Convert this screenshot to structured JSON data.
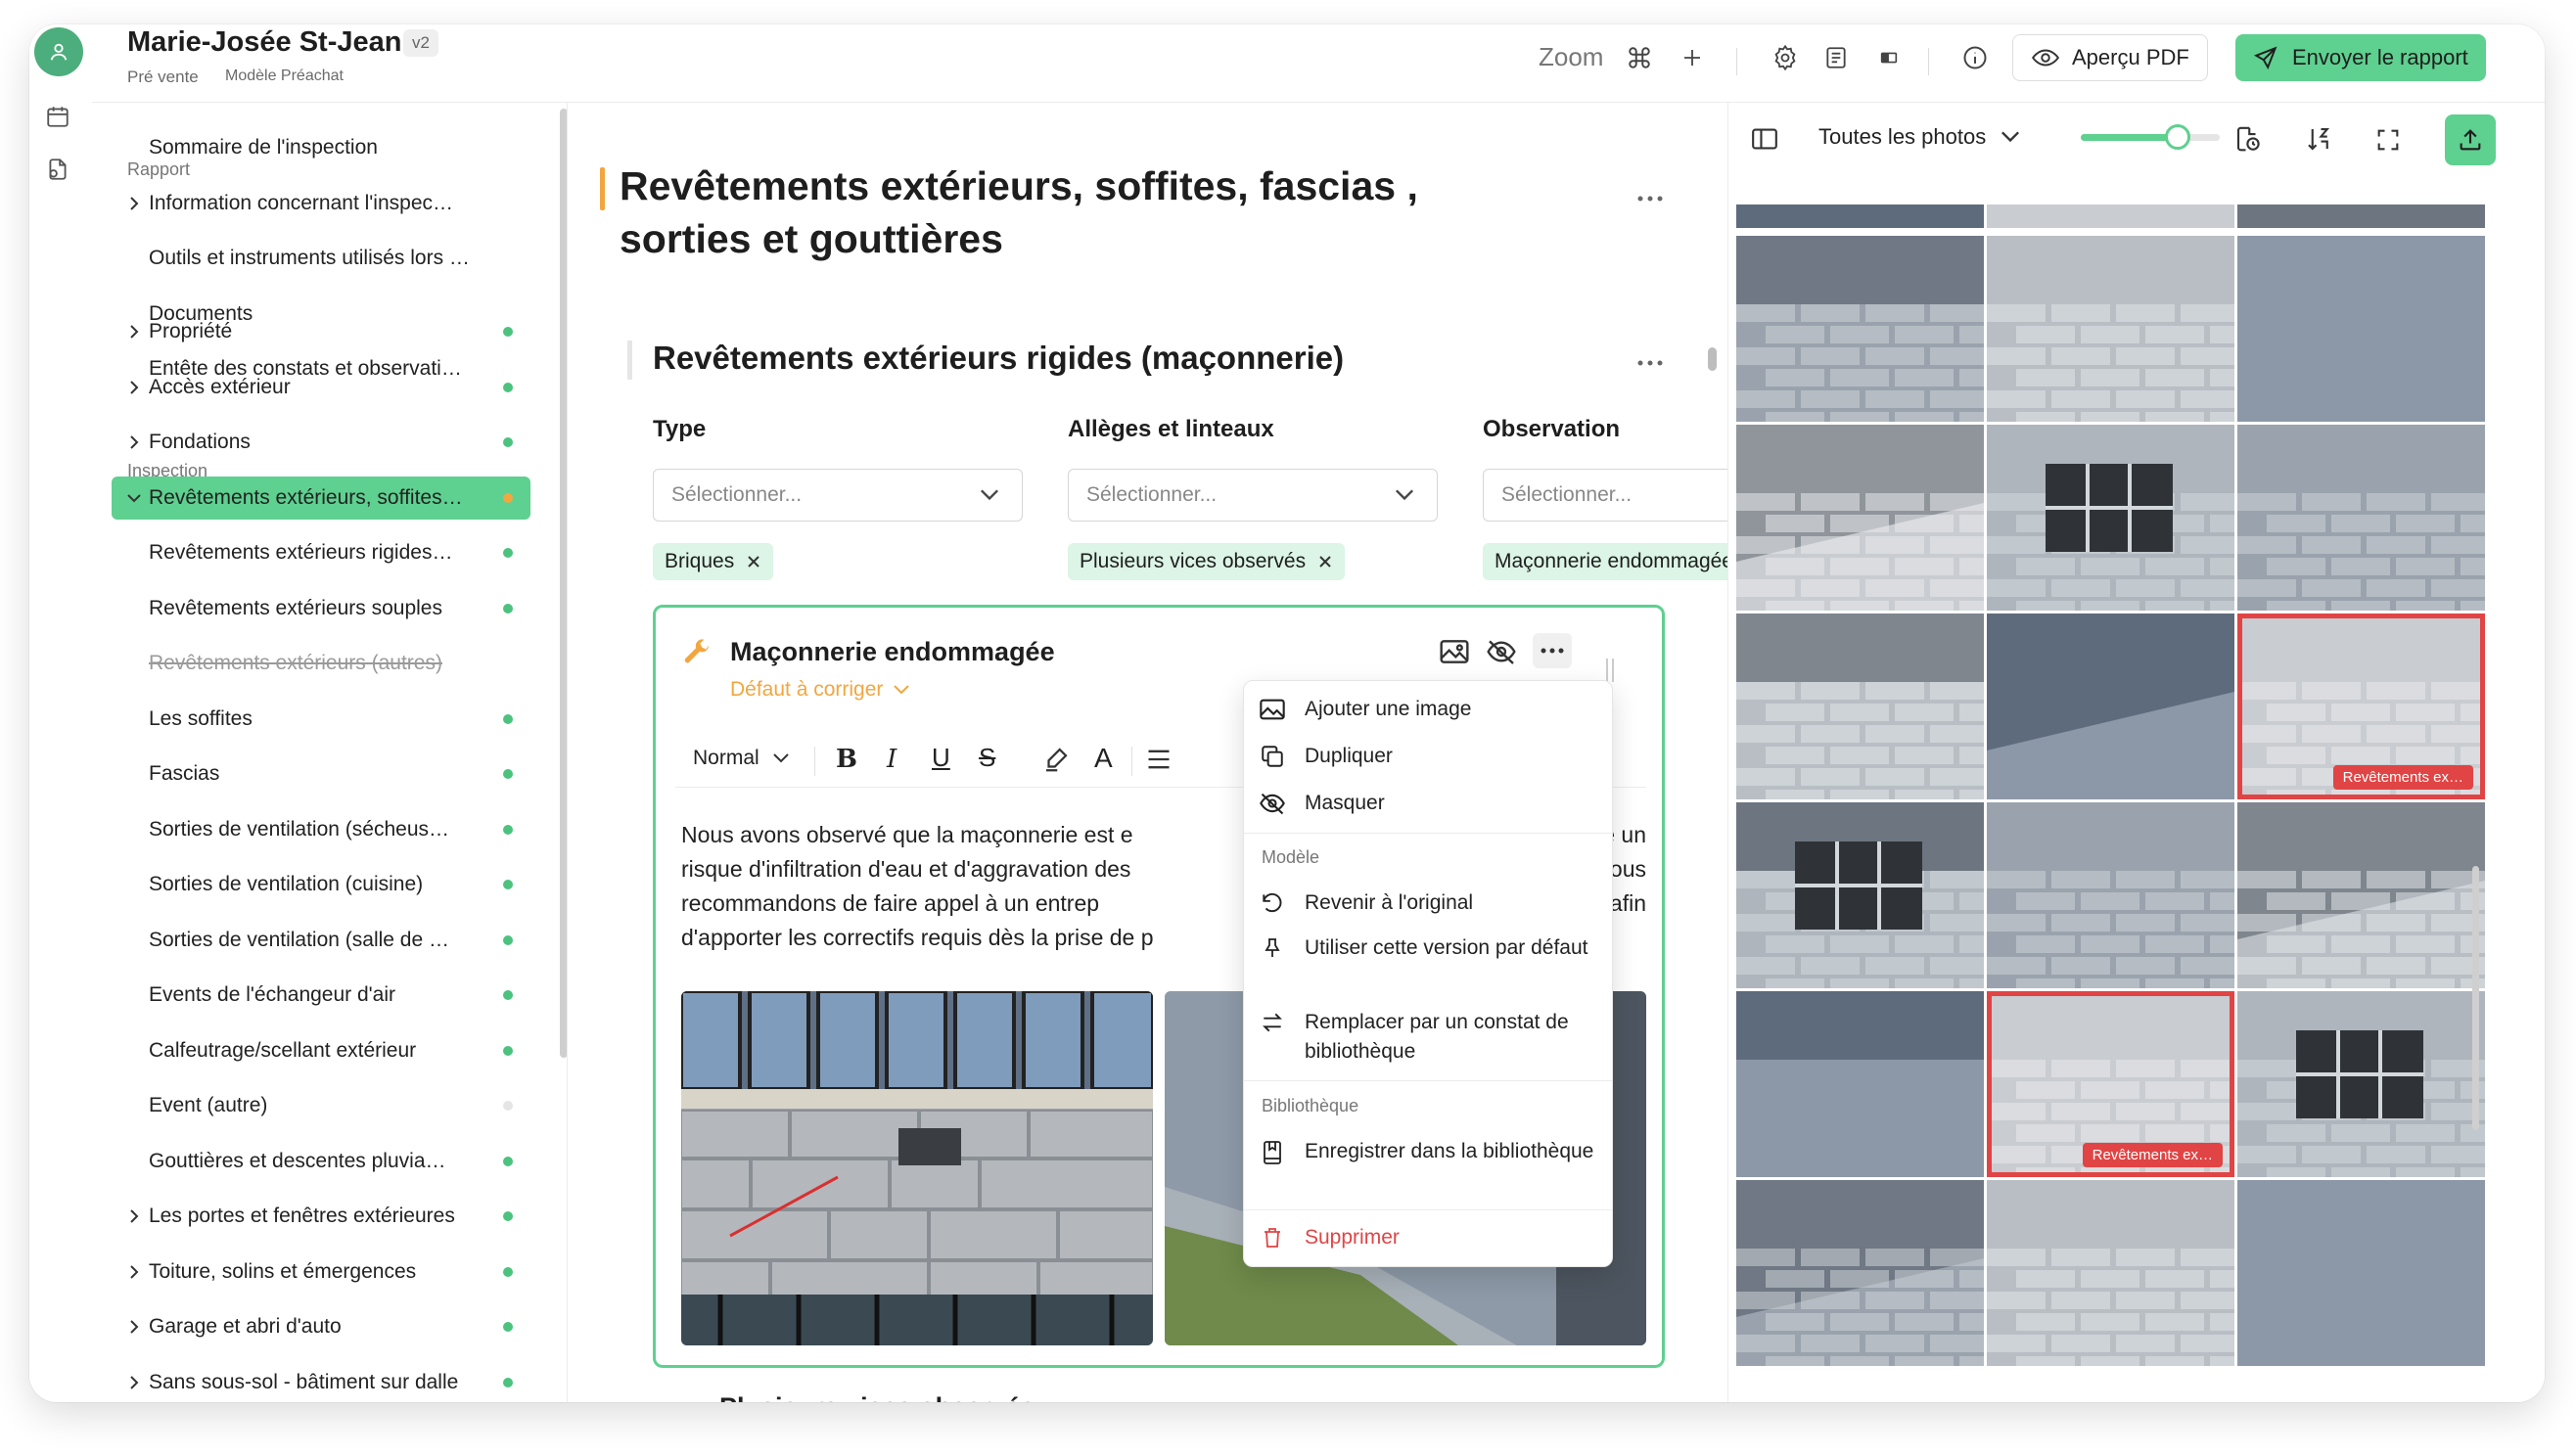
{
  "header": {
    "title": "Marie-Josée St-Jean",
    "version": "v2",
    "stage": "Pré vente",
    "model": "Modèle Préachat",
    "zoom_label": "Zoom",
    "preview_label": "Aperçu PDF",
    "send_label": "Envoyer le rapport"
  },
  "sidebar": {
    "section_rapport": "Rapport",
    "rapport_items": [
      "Sommaire de l'inspection",
      "Information concernant l'inspec…",
      "Outils et instruments utilisés lors …",
      "Documents",
      "Entête des constats et observati…"
    ],
    "section_inspection": "Inspection",
    "inspection_items": [
      "Propriété",
      "Accès extérieur",
      "Fondations",
      "Revêtements extérieurs, soffites…"
    ],
    "sub_items": [
      "Revêtements extérieurs rigides…",
      "Revêtements extérieurs souples",
      "Revêtements extérieurs (autres)",
      "Les soffites",
      "Fascias",
      "Sorties de ventilation (sécheus…",
      "Sorties de ventilation (cuisine)",
      "Sorties de ventilation (salle de …",
      "Events de l'échangeur d'air",
      "Calfeutrage/scellant extérieur",
      "Event (autre)",
      "Gouttières et descentes pluvia…"
    ],
    "after_items": [
      "Les portes et fenêtres extérieures",
      "Toiture, solins et émergences",
      "Garage et abri d'auto",
      "Sans sous-sol - bâtiment sur dalle"
    ]
  },
  "main": {
    "title_line1": "Revêtements extérieurs, soffites, fascias ,",
    "title_line2": "sorties et gouttières",
    "section_title": "Revêtements extérieurs rigides (maçonnerie)",
    "columns": [
      {
        "label": "Type",
        "placeholder": "Sélectionner...",
        "tag": "Briques"
      },
      {
        "label": "Allèges et linteaux",
        "placeholder": "Sélectionner...",
        "tag": "Plusieurs vices observés"
      },
      {
        "label": "Observation",
        "placeholder": "Sélectionner...",
        "tag": "Maçonnerie endommagée"
      }
    ],
    "card": {
      "title": "Maçonnerie endommagée",
      "status": "Défaut à corriger",
      "format": "Normal",
      "text_lines": [
        "Nous avons observé que la maçonnerie est e",
        "risque d'infiltration d'eau et d'aggravation des",
        "recommandons de faire appel à un entrep",
        "d'apporter les correctifs requis dès la prise de p"
      ],
      "text_right": [
        "ose un",
        "s vous",
        "e afin",
        ""
      ]
    },
    "next_card_title": "Plusieurs vices observés"
  },
  "menu": {
    "items_top": [
      "Ajouter une image",
      "Dupliquer",
      "Masquer"
    ],
    "header_model": "Modèle",
    "items_model": [
      "Revenir à l'original",
      "Utiliser cette version par défaut",
      "Remplacer par un constat de bibliothèque"
    ],
    "header_library": "Bibliothèque",
    "items_library": [
      "Enregistrer dans la bibliothèque"
    ],
    "delete": "Supprimer"
  },
  "photos": {
    "filter_label": "Toutes les photos",
    "slider_value": 0.7,
    "tag_1": "Revêtements ex…",
    "tag_2": "Revêtements ex…"
  },
  "colors": {
    "accent_green": "#5ed08f",
    "accent_orange": "#f2a640",
    "danger": "#e14444",
    "status_dot": "#4cc27f"
  }
}
